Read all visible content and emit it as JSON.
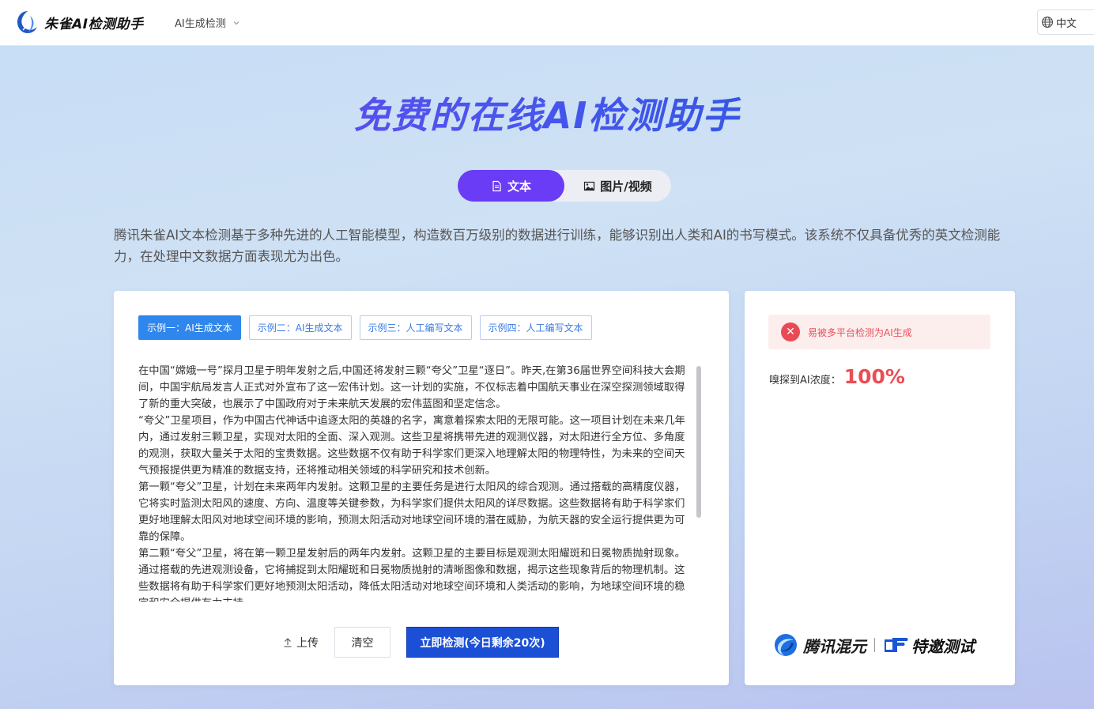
{
  "header": {
    "logo_text": "朱雀AI检测助手",
    "nav_menu_label": "AI生成检测",
    "language": "中文"
  },
  "hero": {
    "title": "免费的在线AI检测助手",
    "tabs": [
      {
        "label": "文本",
        "active": true
      },
      {
        "label": "图片/视频",
        "active": false
      }
    ],
    "description": "腾讯朱雀AI文本检测基于多种先进的人工智能模型，构造数百万级别的数据进行训练，能够识别出人类和AI的书写模式。该系统不仅具备优秀的英文检测能力，在处理中文数据方面表现尤为出色。"
  },
  "main": {
    "examples": [
      {
        "label": "示例一：AI生成文本",
        "active": true
      },
      {
        "label": "示例二：AI生成文本",
        "active": false
      },
      {
        "label": "示例三：人工编写文本",
        "active": false
      },
      {
        "label": "示例四：人工编写文本",
        "active": false
      }
    ],
    "text_paragraphs": [
      "在中国“嫦娥一号”探月卫星于明年发射之后,中国还将发射三颗“夸父”卫星“逐日”。昨天,在第36届世界空间科技大会期间，中国宇航局发言人正式对外宣布了这一宏伟计划。这一计划的实施，不仅标志着中国航天事业在深空探测领域取得了新的重大突破，也展示了中国政府对于未来航天发展的宏伟蓝图和坚定信念。",
      "“夸父”卫星项目，作为中国古代神话中追逐太阳的英雄的名字，寓意着探索太阳的无限可能。这一项目计划在未来几年内，通过发射三颗卫星，实现对太阳的全面、深入观测。这些卫星将携带先进的观测仪器，对太阳进行全方位、多角度的观测，获取大量关于太阳的宝贵数据。这些数据不仅有助于科学家们更深入地理解太阳的物理特性，为未来的空间天气预报提供更为精准的数据支持，还将推动相关领域的科学研究和技术创新。",
      "第一颗“夸父”卫星，计划在未来两年内发射。这颗卫星的主要任务是进行太阳风的综合观测。通过搭载的高精度仪器，它将实时监测太阳风的速度、方向、温度等关键参数，为科学家们提供太阳风的详尽数据。这些数据将有助于科学家们更好地理解太阳风对地球空间环境的影响，预测太阳活动对地球空间环境的潜在威胁，为航天器的安全运行提供更为可靠的保障。",
      "第二颗“夸父”卫星，将在第一颗卫星发射后的两年内发射。这颗卫星的主要目标是观测太阳耀斑和日冕物质抛射现象。通过搭载的先进观测设备，它将捕捉到太阳耀斑和日冕物质抛射的清晰图像和数据，揭示这些现象背后的物理机制。这些数据将有助于科学家们更好地预测太阳活动，降低太阳活动对地球空间环境和人类活动的影响，为地球空间环境的稳定和安全提供有力支持。"
    ],
    "upload_label": "上传",
    "clear_label": "清空",
    "detect_label": "立即检测(今日剩余20次)"
  },
  "result": {
    "alert_text": "易被多平台检测为AI生成",
    "score_label": "嗅探到AI浓度：",
    "score_value": "100%",
    "brand_name": "腾讯混元",
    "invite_text": "特邀测试"
  },
  "colors": {
    "accent_purple": "#6a3cf5",
    "primary_blue": "#1a4fd6",
    "example_blue": "#2f86ec",
    "danger_red": "#ea4d55"
  }
}
